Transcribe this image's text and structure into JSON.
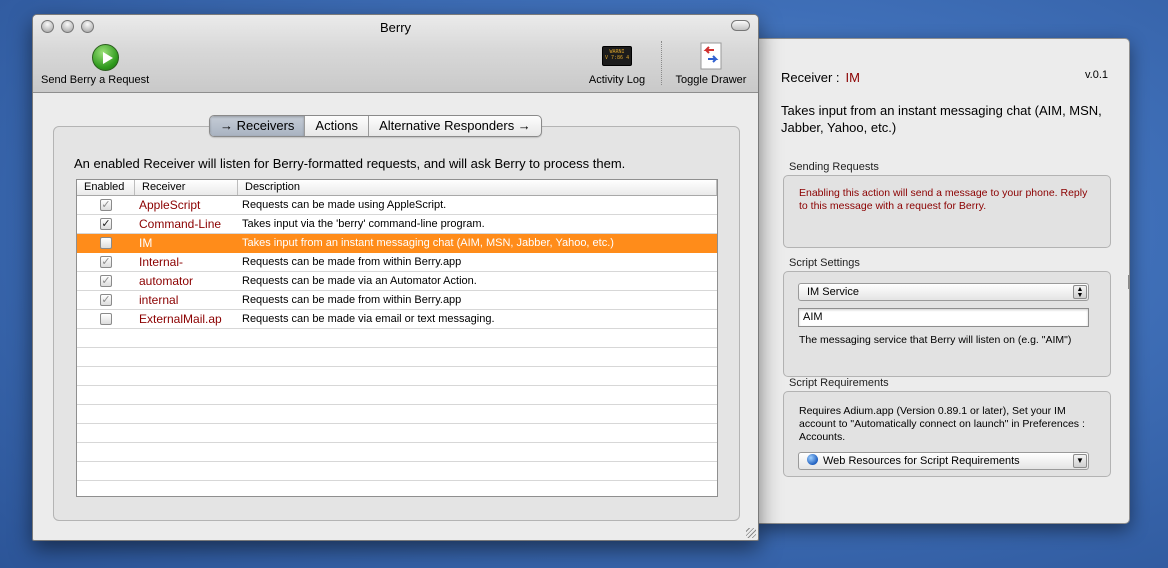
{
  "window": {
    "title": "Berry",
    "toolbar": {
      "send_label": "Send Berry a Request",
      "activity_label": "Activity Log",
      "drawer_label": "Toggle Drawer",
      "log_icon_text": "WARNI\nV 7:86 4"
    },
    "tabs": [
      {
        "label": "→  Receivers"
      },
      {
        "label": "Actions"
      },
      {
        "label": "Alternative Responders  →"
      }
    ],
    "intro": "An enabled Receiver will listen for Berry-formatted requests, and will ask Berry to process them.",
    "table": {
      "headers": {
        "enabled": "Enabled",
        "receiver": "Receiver",
        "description": "Description"
      },
      "rows": [
        {
          "checked": "✓",
          "receiver": "AppleScript",
          "description": "Requests can be made using AppleScript."
        },
        {
          "checked": "✓",
          "receiver": "Command-Line",
          "description": "Takes input via the 'berry' command-line program."
        },
        {
          "checked": "",
          "receiver": "IM",
          "description": "Takes input from an instant messaging chat (AIM, MSN, Jabber, Yahoo, etc.)"
        },
        {
          "checked": "✓",
          "receiver": "Internal-",
          "description": "Requests can be made from within Berry.app"
        },
        {
          "checked": "✓",
          "receiver": "automator",
          "description": "Requests can be made via an Automator Action."
        },
        {
          "checked": "✓",
          "receiver": "internal",
          "description": "Requests can be made from within Berry.app"
        },
        {
          "checked": "",
          "receiver": "ExternalMail.ap",
          "description": "Requests can be made via email or text messaging."
        }
      ]
    }
  },
  "drawer": {
    "title_prefix": "Receiver :",
    "title_name": "IM",
    "version": "v.0.1",
    "description": "Takes input from an instant messaging chat (AIM, MSN, Jabber, Yahoo, etc.)",
    "sending": {
      "label": "Sending Requests",
      "text": "Enabling this action will send a message to your phone. Reply to this message with a request for Berry."
    },
    "settings": {
      "label": "Script Settings",
      "service_select": "IM Service",
      "service_value": "AIM",
      "hint": "The messaging service that Berry will listen on (e.g. \"AIM\")"
    },
    "requirements": {
      "label": "Script Requirements",
      "text": "Requires Adium.app (Version 0.89.1 or later), Set your IM account to \"Automatically connect on launch\" in Preferences : Accounts.",
      "web_button": "Web Resources for Script Requirements"
    }
  },
  "colors": {
    "selection": "#ff8c1a",
    "receiver_text": "#8b0000",
    "desktop": "#3f6fb8"
  }
}
